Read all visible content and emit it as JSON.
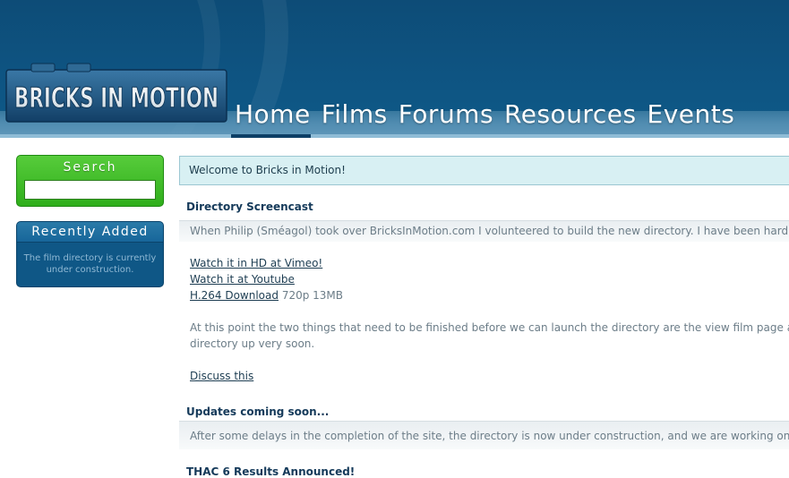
{
  "logo": {
    "text": "BRICKS IN MOTION"
  },
  "nav": [
    {
      "label": "Home",
      "active": true
    },
    {
      "label": "Films",
      "active": false
    },
    {
      "label": "Forums",
      "active": false
    },
    {
      "label": "Resources",
      "active": false
    },
    {
      "label": "Events",
      "active": false
    }
  ],
  "sidebar": {
    "search": {
      "title": "Search",
      "placeholder": ""
    },
    "recent": {
      "title": "Recently Added",
      "body_line1": "The film directory is currently",
      "body_line2": "under construction."
    }
  },
  "welcome": "Welcome to Bricks in Motion!",
  "posts": [
    {
      "title": "Directory Screencast",
      "intro": "When Philip (Sméagol) took over BricksInMotion.com I volunteered to build the new directory. I have been hard at wo",
      "links": {
        "vimeo": "Watch it in HD at Vimeo!",
        "youtube": "Watch it at Youtube",
        "h264": "H.264 Download",
        "h264_note": "720p 13MB"
      },
      "para_line1": "At this point the two things that need to be finished before we can launch the directory are the view film page and t",
      "para_line2": "directory up very soon.",
      "discuss": "Discuss this"
    },
    {
      "title": "Updates coming soon...",
      "intro": "After some delays in the completion of the site, the directory is now under construction, and we are working on a ne"
    },
    {
      "title": "THAC 6 Results Announced!"
    }
  ],
  "colors": {
    "header": "#0e5482",
    "search_green": "#2fae1b",
    "recent_blue": "#0f5786",
    "welcome_bg": "#d8f0f3"
  }
}
